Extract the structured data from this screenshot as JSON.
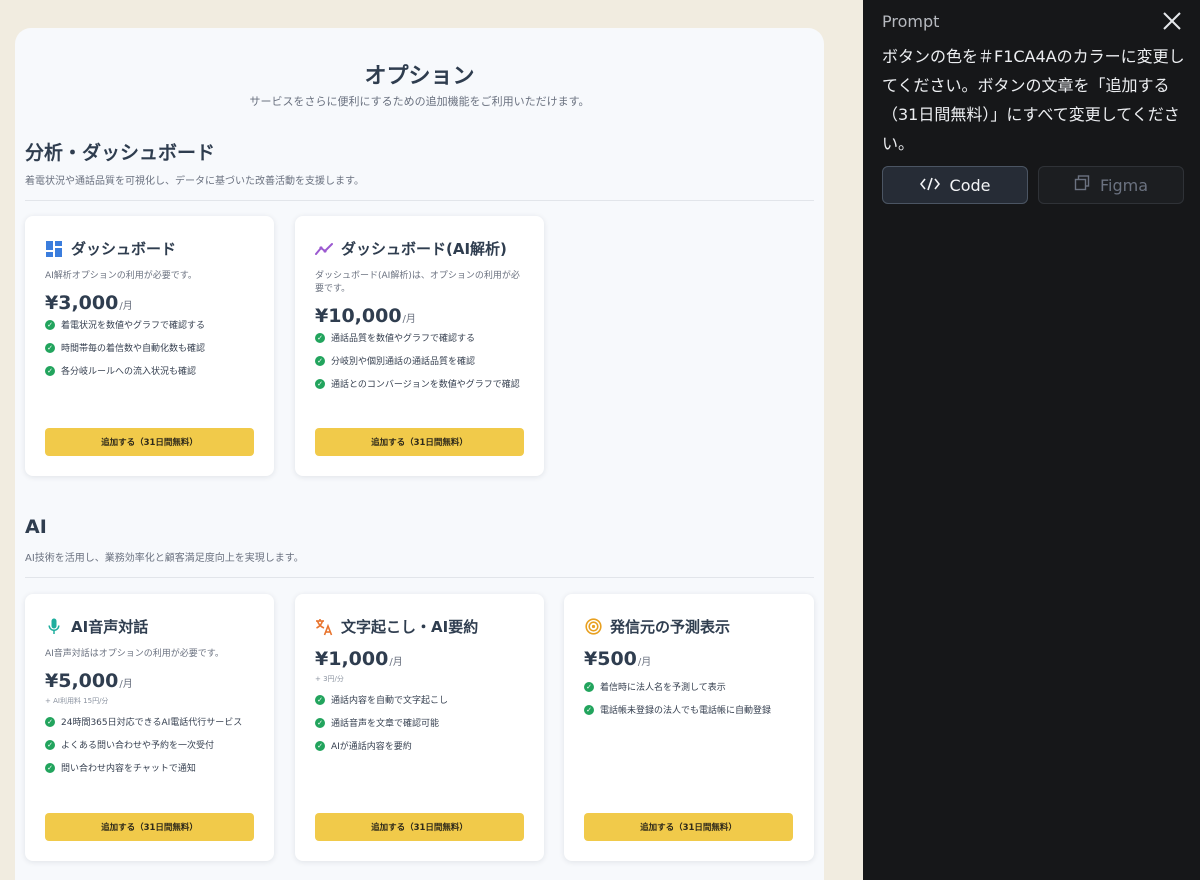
{
  "page": {
    "title": "オプション",
    "subtitle": "サービスをさらに便利にするための追加機能をご利用いただけます。"
  },
  "colors": {
    "accent_button": "#F1CA4A",
    "check": "#22A45D",
    "dashboard_icon": "#3B7DDD",
    "ai_dashboard_icon": "#9B59D0",
    "mic_icon": "#1FAE9E",
    "translate_icon": "#E8742E",
    "target_icon": "#E8A020"
  },
  "sections": [
    {
      "title": "分析・ダッシュボード",
      "desc": "着電状況や通話品質を可視化し、データに基づいた改善活動を支援します。",
      "cards": [
        {
          "icon": "dashboard-icon",
          "title": "ダッシュボード",
          "note": "AI解析オプションの利用が必要です。",
          "price": "¥3,000",
          "unit": "/月",
          "features": [
            "着電状況を数値やグラフで確認する",
            "時間帯毎の着信数や自動化数も確認",
            "各分岐ルールへの流入状況も確認"
          ],
          "button": "追加する（31日間無料）"
        },
        {
          "icon": "trend-icon",
          "title": "ダッシュボード(AI解析)",
          "note": "ダッシュボード(AI解析)は、オプションの利用が必要です。",
          "price": "¥10,000",
          "unit": "/月",
          "features": [
            "通話品質を数値やグラフで確認する",
            "分岐別や個別通話の通話品質を確認",
            "通話とのコンバージョンを数値やグラフで確認"
          ],
          "button": "追加する（31日間無料）"
        }
      ]
    },
    {
      "title": "AI",
      "desc": "AI技術を活用し、業務効率化と顧客満足度向上を実現します。",
      "cards": [
        {
          "icon": "microphone-icon",
          "title": "AI音声対話",
          "note": "AI音声対話はオプションの利用が必要です。",
          "price": "¥5,000",
          "unit": "/月",
          "price_sub": "+ AI利用料 15円/分",
          "features": [
            "24時間365日対応できるAI電話代行サービス",
            "よくある問い合わせや予約を一次受付",
            "問い合わせ内容をチャットで通知"
          ],
          "button": "追加する（31日間無料）"
        },
        {
          "icon": "translate-icon",
          "title": "文字起こし・AI要約",
          "price": "¥1,000",
          "unit": "/月",
          "price_sub": "+ 3円/分",
          "features": [
            "通話内容を自動で文字起こし",
            "通話音声を文章で確認可能",
            "AIが通話内容を要約"
          ],
          "button": "追加する（31日間無料）"
        },
        {
          "icon": "target-icon",
          "title": "発信元の予測表示",
          "price": "¥500",
          "unit": "/月",
          "features": [
            "着信時に法人名を予測して表示",
            "電話帳未登録の法人でも電話帳に自動登録"
          ],
          "button": "追加する（31日間無料）"
        }
      ]
    }
  ],
  "prompt_panel": {
    "label": "Prompt",
    "text": "ボタンの色を＃F1CA4Aのカラーに変更してください。ボタンの文章を「追加する（31日間無料）」にすべて変更してください。",
    "tabs": [
      {
        "icon": "code-icon",
        "label": "Code"
      },
      {
        "icon": "copy-icon",
        "label": "Figma"
      }
    ]
  }
}
